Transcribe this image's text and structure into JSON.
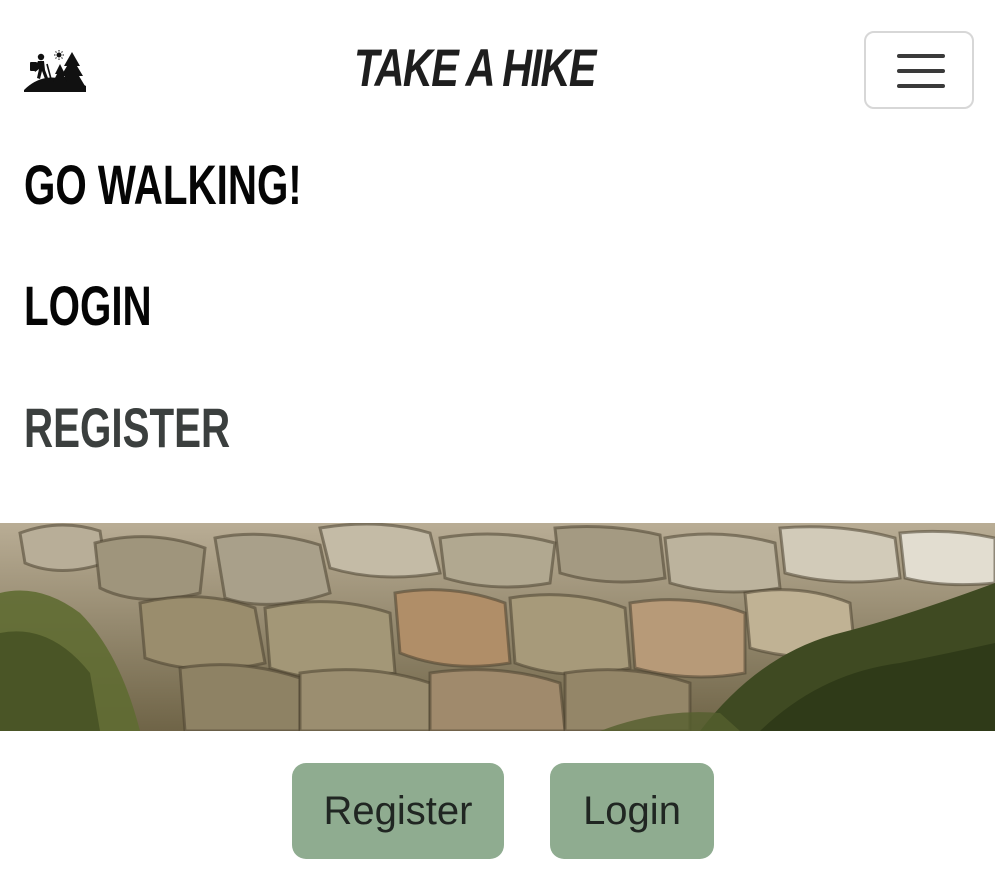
{
  "header": {
    "logo_icon": "hiker-trees-icon",
    "brand_title": "TAKE A HIKE",
    "menu_icon": "hamburger-menu-icon"
  },
  "nav": {
    "items": [
      {
        "label": "GO WALKING!"
      },
      {
        "label": "LOGIN"
      },
      {
        "label": "REGISTER"
      }
    ]
  },
  "hero": {
    "image": "rocky-stone-wall-photo"
  },
  "actions": {
    "register_label": "Register",
    "login_label": "Login"
  },
  "colors": {
    "button_bg": "#8fac90",
    "button_text": "#202622",
    "nav_text": "#050505",
    "nav_active_text": "#3b3f3e"
  }
}
